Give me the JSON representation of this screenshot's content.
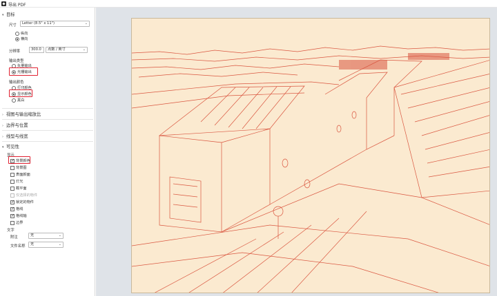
{
  "window": {
    "title": "导出 PDF"
  },
  "sections": {
    "target": {
      "header": "目标",
      "size_label": "尺寸",
      "size_value": "Letter (8.5\" x 11\")",
      "orientation_options": [
        "纵向",
        "横向"
      ],
      "orientation_selected": "横向",
      "resolution_label": "分辨率",
      "resolution_value": "300.0",
      "resolution_unit": "点数 / 英寸"
    },
    "output_type": {
      "label": "输出类型",
      "options": [
        "矢量输出",
        "光栅输出"
      ],
      "selected": "光栅输出"
    },
    "output_color": {
      "label": "输出颜色",
      "options": [
        "打印颜色",
        "显示颜色",
        "黑白"
      ],
      "selected": "显示颜色"
    },
    "collapsed": [
      "视图与输出缩放比",
      "边界与位置",
      "线型与线宽"
    ],
    "visibility": {
      "header": "可见性",
      "display_label": "显示",
      "items": [
        {
          "label": "背景颜色",
          "checked": true,
          "disabled": false
        },
        {
          "label": "背景图",
          "checked": false,
          "disabled": false
        },
        {
          "label": "表面颜面",
          "checked": false,
          "disabled": false
        },
        {
          "label": "灯光",
          "checked": false,
          "disabled": false
        },
        {
          "label": "截平面",
          "checked": false,
          "disabled": false
        },
        {
          "label": "仅选择的物件",
          "checked": false,
          "disabled": true
        },
        {
          "label": "锁定的物件",
          "checked": true,
          "disabled": false
        },
        {
          "label": "格线",
          "checked": true,
          "disabled": false
        },
        {
          "label": "格线轴",
          "checked": true,
          "disabled": false
        },
        {
          "label": "边界",
          "checked": false,
          "disabled": false
        }
      ]
    },
    "text": {
      "label": "文字",
      "annotation_label": "附注",
      "annotation_value": "无",
      "filename_label": "文件名称",
      "filename_value": "无"
    }
  },
  "colors": {
    "highlight": "#e02030",
    "line_art": "#d9553f",
    "page_bg": "#fbead0",
    "preview_bg": "#dfe3e8"
  }
}
